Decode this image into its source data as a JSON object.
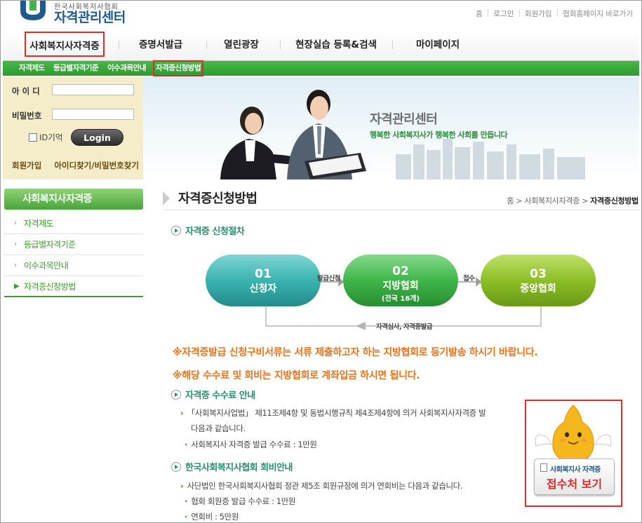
{
  "logo": {
    "org_small": "한국사회복지사협회",
    "org_big": "자격관리센터"
  },
  "util_links": [
    "홈",
    "로그인",
    "회원가입",
    "협회홈페이지 바로가기"
  ],
  "gnb": [
    "사회복지사자격증",
    "증명서발급",
    "열린광장",
    "현장실습 등록&검색",
    "마이페이지"
  ],
  "lnb": [
    "자격제도",
    "등급별자격기준",
    "이수과목안내",
    "자격증신청방법"
  ],
  "login": {
    "id_label": "아 이 디",
    "pw_label": "비밀번호",
    "remember_label": "ID기억",
    "login_button": "Login",
    "signup_link": "회원가입",
    "find_link": "아이디찾기/비밀번호찾기"
  },
  "banner": {
    "title": "자격관리센터",
    "subtitle": "행복한 사회복지사가 행복한 사회를 만듭니다"
  },
  "sidebar": {
    "title": "사회복지사자격증",
    "items": [
      "자격제도",
      "등급별자격기준",
      "이수과목안내",
      "자격증신청방법"
    ]
  },
  "page": {
    "title": "자격증신청방법",
    "breadcrumb": {
      "home": "홈",
      "sep": ">",
      "parent": "사회복지사자격증",
      "current": "자격증신청방법"
    }
  },
  "process": {
    "heading": "자격증 신청절차",
    "steps": [
      {
        "num": "01",
        "label": "신청자",
        "sub": ""
      },
      {
        "num": "02",
        "label": "지방협회",
        "sub": "(전국 16개)"
      },
      {
        "num": "03",
        "label": "중앙협회",
        "sub": ""
      }
    ],
    "arrow1": "발급신청",
    "arrow2": "접수",
    "return": "자격심사, 자격증발급",
    "colors": {
      "step1": "#3ab3b0",
      "step2": "#3fb64a",
      "step3": "#8cbf26"
    }
  },
  "notices": [
    "※자격증발급 신청구비서류는 서류 제출하고자 하는 지방협회로 등기발송 하시기 바랍니다.",
    "※해당 수수료 및 회비는 지방협회로 계좌입금 하시면 됩니다."
  ],
  "fee": {
    "heading": "자격증 수수료 안내",
    "line1": "「사회복지사업법」 제11조제4항 및 동법시행규칙 제4조제4항에 의거 사회복지사자격증 발",
    "line2": "다음과 같습니다.",
    "item": "사회복지사 자격증 발급 수수료 : 1만원"
  },
  "membership": {
    "heading": "한국사회복지사협회 회비안내",
    "line1": "사단법인 한국사회복지사협회 정관 제5조 회원규정에 의거 연회비는 다음과 같습니다.",
    "items": [
      "협회 회원증 발급 수수료 : 1만원",
      "연회비 : 5만원"
    ]
  },
  "reception": {
    "top": "사회복지사 자격증",
    "main": "접수처 보기"
  }
}
